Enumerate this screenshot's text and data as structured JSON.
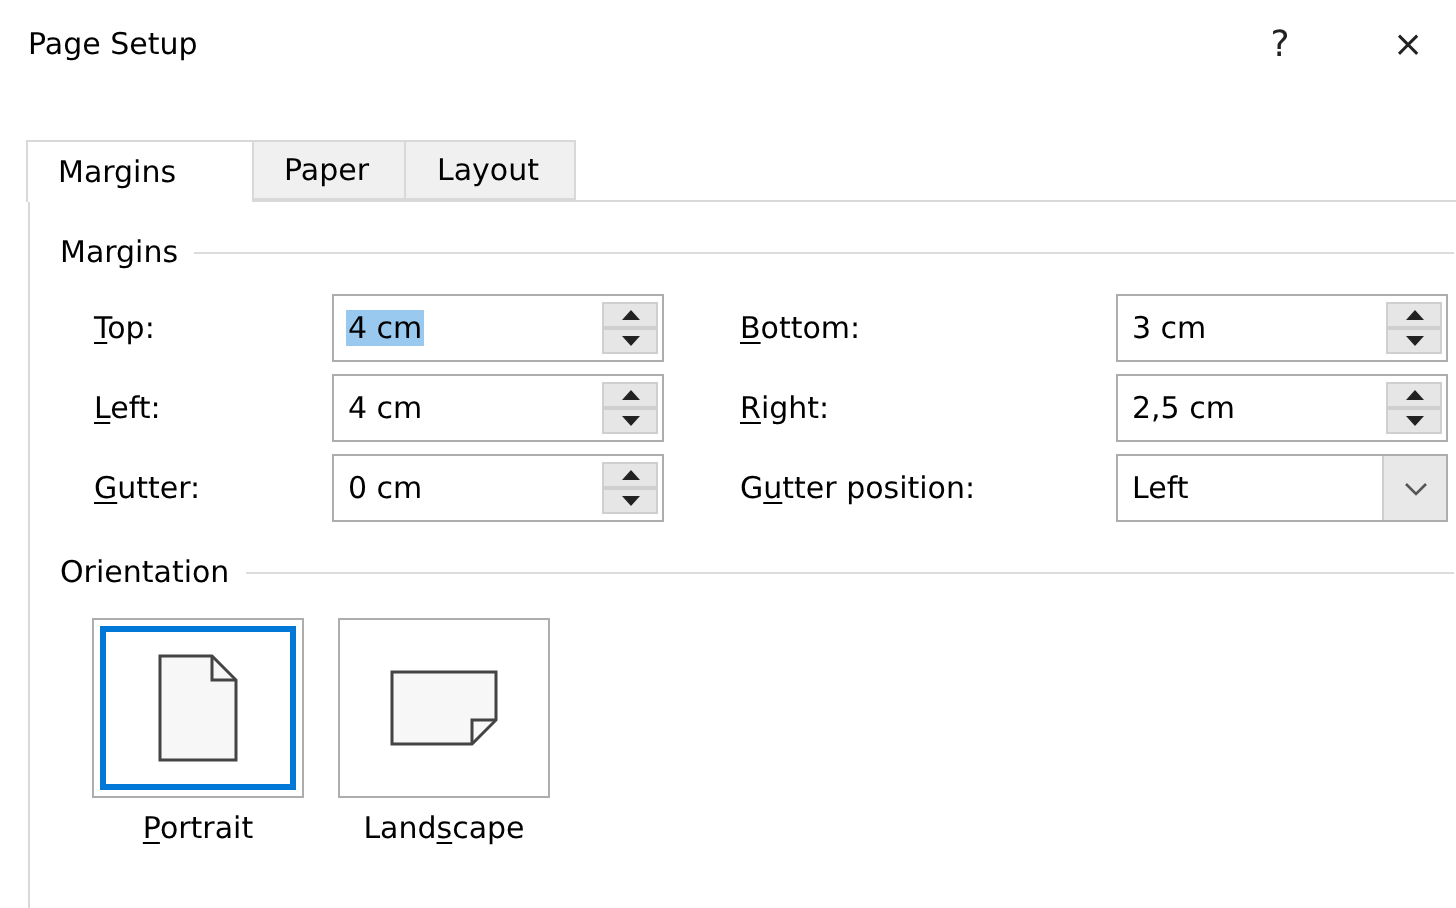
{
  "window": {
    "title": "Page Setup",
    "help": "?",
    "close": "×"
  },
  "tabs": [
    {
      "label": "Margins",
      "selected": true
    },
    {
      "label": "Paper",
      "selected": false
    },
    {
      "label": "Layout",
      "selected": false
    }
  ],
  "margins_group": {
    "title": "Margins",
    "fields": [
      {
        "label": {
          "access_key": "T",
          "after": "op:"
        },
        "value": "4 cm",
        "kind": "spinner",
        "text_selected": true
      },
      {
        "label": {
          "access_key": "B",
          "after": "ottom:"
        },
        "value": "3 cm",
        "kind": "spinner",
        "text_selected": false
      },
      {
        "label": {
          "access_key": "L",
          "after": "eft:"
        },
        "value": "4 cm",
        "kind": "spinner",
        "text_selected": false
      },
      {
        "label": {
          "access_key": "R",
          "after": "ight:"
        },
        "value": "2,5 cm",
        "kind": "spinner",
        "text_selected": false
      },
      {
        "label": {
          "access_key": "G",
          "after": "utter:"
        },
        "value": "0 cm",
        "kind": "spinner",
        "text_selected": false
      },
      {
        "label": {
          "before": "G",
          "access_key": "u",
          "after": "tter position:"
        },
        "value": "Left",
        "kind": "dropdown",
        "text_selected": false
      }
    ]
  },
  "orientation_group": {
    "title": "Orientation",
    "options": [
      {
        "label": {
          "access_key": "P",
          "after": "ortrait"
        },
        "kind": "portrait",
        "selected": true
      },
      {
        "label": {
          "before": "Land",
          "access_key": "s",
          "after": "cape"
        },
        "kind": "landscape",
        "selected": false
      }
    ]
  }
}
